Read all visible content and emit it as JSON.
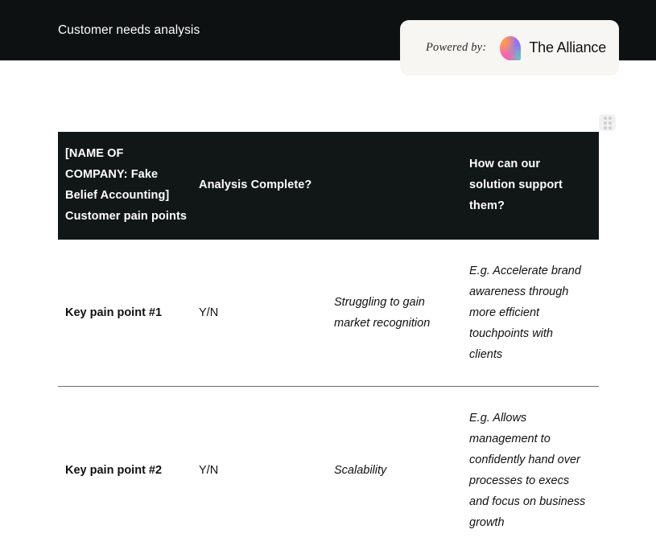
{
  "topnav": {
    "title": "Customer needs analysis",
    "background_color": "#0d1111"
  },
  "powered_badge": {
    "label": "Powered by:",
    "brand_name": "The Alliance",
    "logo_icon": "alliance-gradient-blob-logo",
    "background_color": "#f8f6f2"
  },
  "toolbar": {
    "drag_handle_icon": "drag-handle-dots-icon"
  },
  "table": {
    "header_background": "#111717",
    "columns": [
      "[NAME OF COMPANY: Fake Belief Accounting] Customer pain points",
      "Analysis Complete?",
      "",
      "How can our solution support them?"
    ],
    "rows": [
      {
        "pain_point": "Key pain point #1",
        "analysis_complete": "Y/N",
        "detail": "Struggling to gain market recognition",
        "solution_support": "E.g. Accelerate brand awareness through more efficient touchpoints with clients"
      },
      {
        "pain_point": "Key pain point #2",
        "analysis_complete": "Y/N",
        "detail": "Scalability",
        "solution_support": "E.g. Allows management to confidently hand over processes to execs and focus on business growth"
      }
    ]
  }
}
